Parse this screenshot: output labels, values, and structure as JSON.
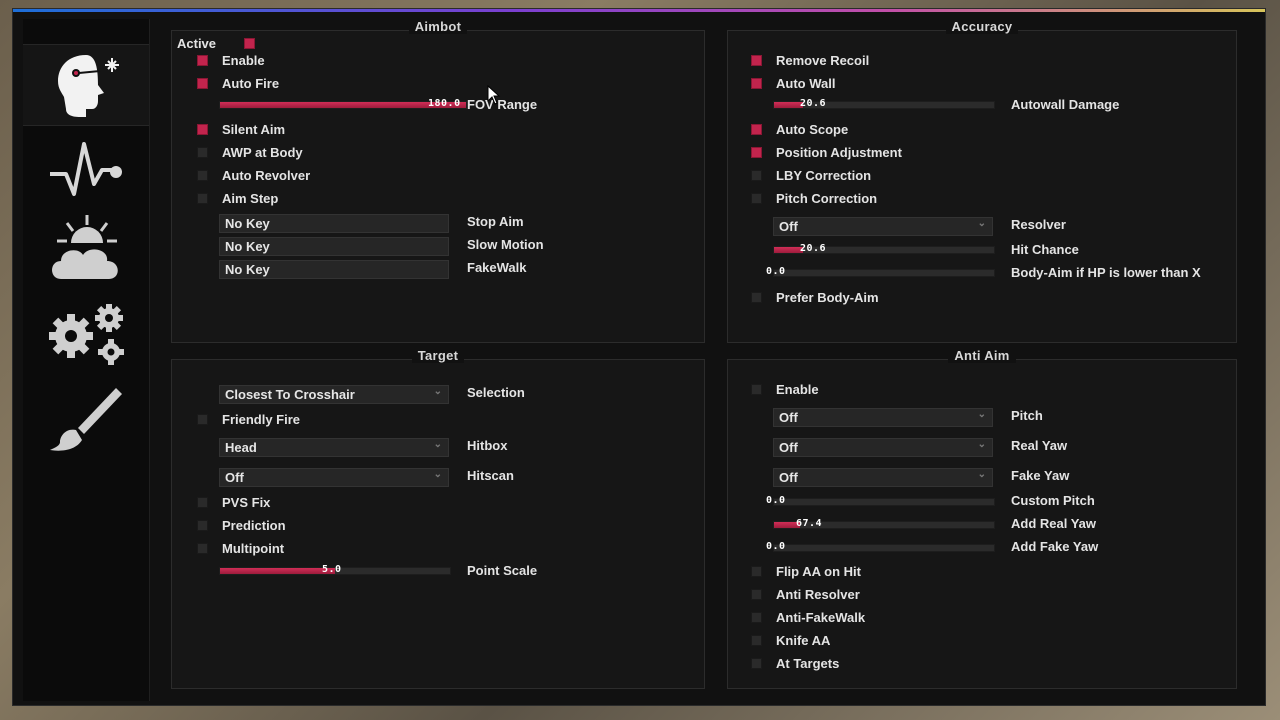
{
  "sidebar": {
    "tabs": [
      {
        "name": "ragebot-head-icon",
        "active": true
      },
      {
        "name": "pulse-icon",
        "active": false
      },
      {
        "name": "weather-cloud-icon",
        "active": false
      },
      {
        "name": "gears-icon",
        "active": false
      },
      {
        "name": "brush-icon",
        "active": false
      }
    ]
  },
  "aimbot": {
    "title": "Aimbot",
    "active_label": "Active",
    "enable": "Enable",
    "auto_fire": "Auto Fire",
    "fov_value": "180.0",
    "fov_label": "FOV Range",
    "fov_fraction": 1.0,
    "silent_aim": "Silent Aim",
    "awp_body": "AWP at Body",
    "auto_revolver": "Auto Revolver",
    "aim_step": "Aim Step",
    "key1": "No Key",
    "key1_label": "Stop Aim",
    "key2": "No Key",
    "key2_label": "Slow Motion",
    "key3": "No Key",
    "key3_label": "FakeWalk"
  },
  "accuracy": {
    "title": "Accuracy",
    "remove_recoil": "Remove Recoil",
    "auto_wall": "Auto Wall",
    "autowall_value": "20.6",
    "autowall_label": "Autowall Damage",
    "autowall_fraction": 0.13,
    "auto_scope": "Auto Scope",
    "position_adj": "Position Adjustment",
    "lby_correction": "LBY Correction",
    "pitch_correction": "Pitch Correction",
    "resolver_value": "Off",
    "resolver_label": "Resolver",
    "hitchance_value": "20.6",
    "hitchance_label": "Hit Chance",
    "hitchance_fraction": 0.13,
    "bodyaim_value": "0.0",
    "bodyaim_label": "Body-Aim if HP is lower than X",
    "prefer_body": "Prefer Body-Aim"
  },
  "target": {
    "title": "Target",
    "selection_value": "Closest To Crosshair",
    "selection_label": "Selection",
    "friendly_fire": "Friendly Fire",
    "hitbox_value": "Head",
    "hitbox_label": "Hitbox",
    "hitscan_value": "Off",
    "hitscan_label": "Hitscan",
    "pvs_fix": "PVS Fix",
    "prediction": "Prediction",
    "multipoint": "Multipoint",
    "pointscale_value": "5.0",
    "pointscale_label": "Point Scale",
    "pointscale_fraction": 0.5
  },
  "antiaim": {
    "title": "Anti Aim",
    "enable": "Enable",
    "pitch_value": "Off",
    "pitch_label": "Pitch",
    "realyaw_value": "Off",
    "realyaw_label": "Real Yaw",
    "fakeyaw_value": "Off",
    "fakeyaw_label": "Fake Yaw",
    "custompitch_value": "0.0",
    "custompitch_label": "Custom Pitch",
    "addreal_value": "67.4",
    "addreal_label": "Add Real Yaw",
    "addreal_fraction": 0.12,
    "addfake_value": "0.0",
    "addfake_label": "Add Fake Yaw",
    "flip_aa": "Flip AA on Hit",
    "anti_resolver": "Anti Resolver",
    "anti_fakewalk": "Anti-FakeWalk",
    "knife_aa": "Knife AA",
    "at_targets": "At Targets"
  },
  "colors": {
    "accent": "#c2244d",
    "background": "#111111",
    "panel": "#161616"
  }
}
